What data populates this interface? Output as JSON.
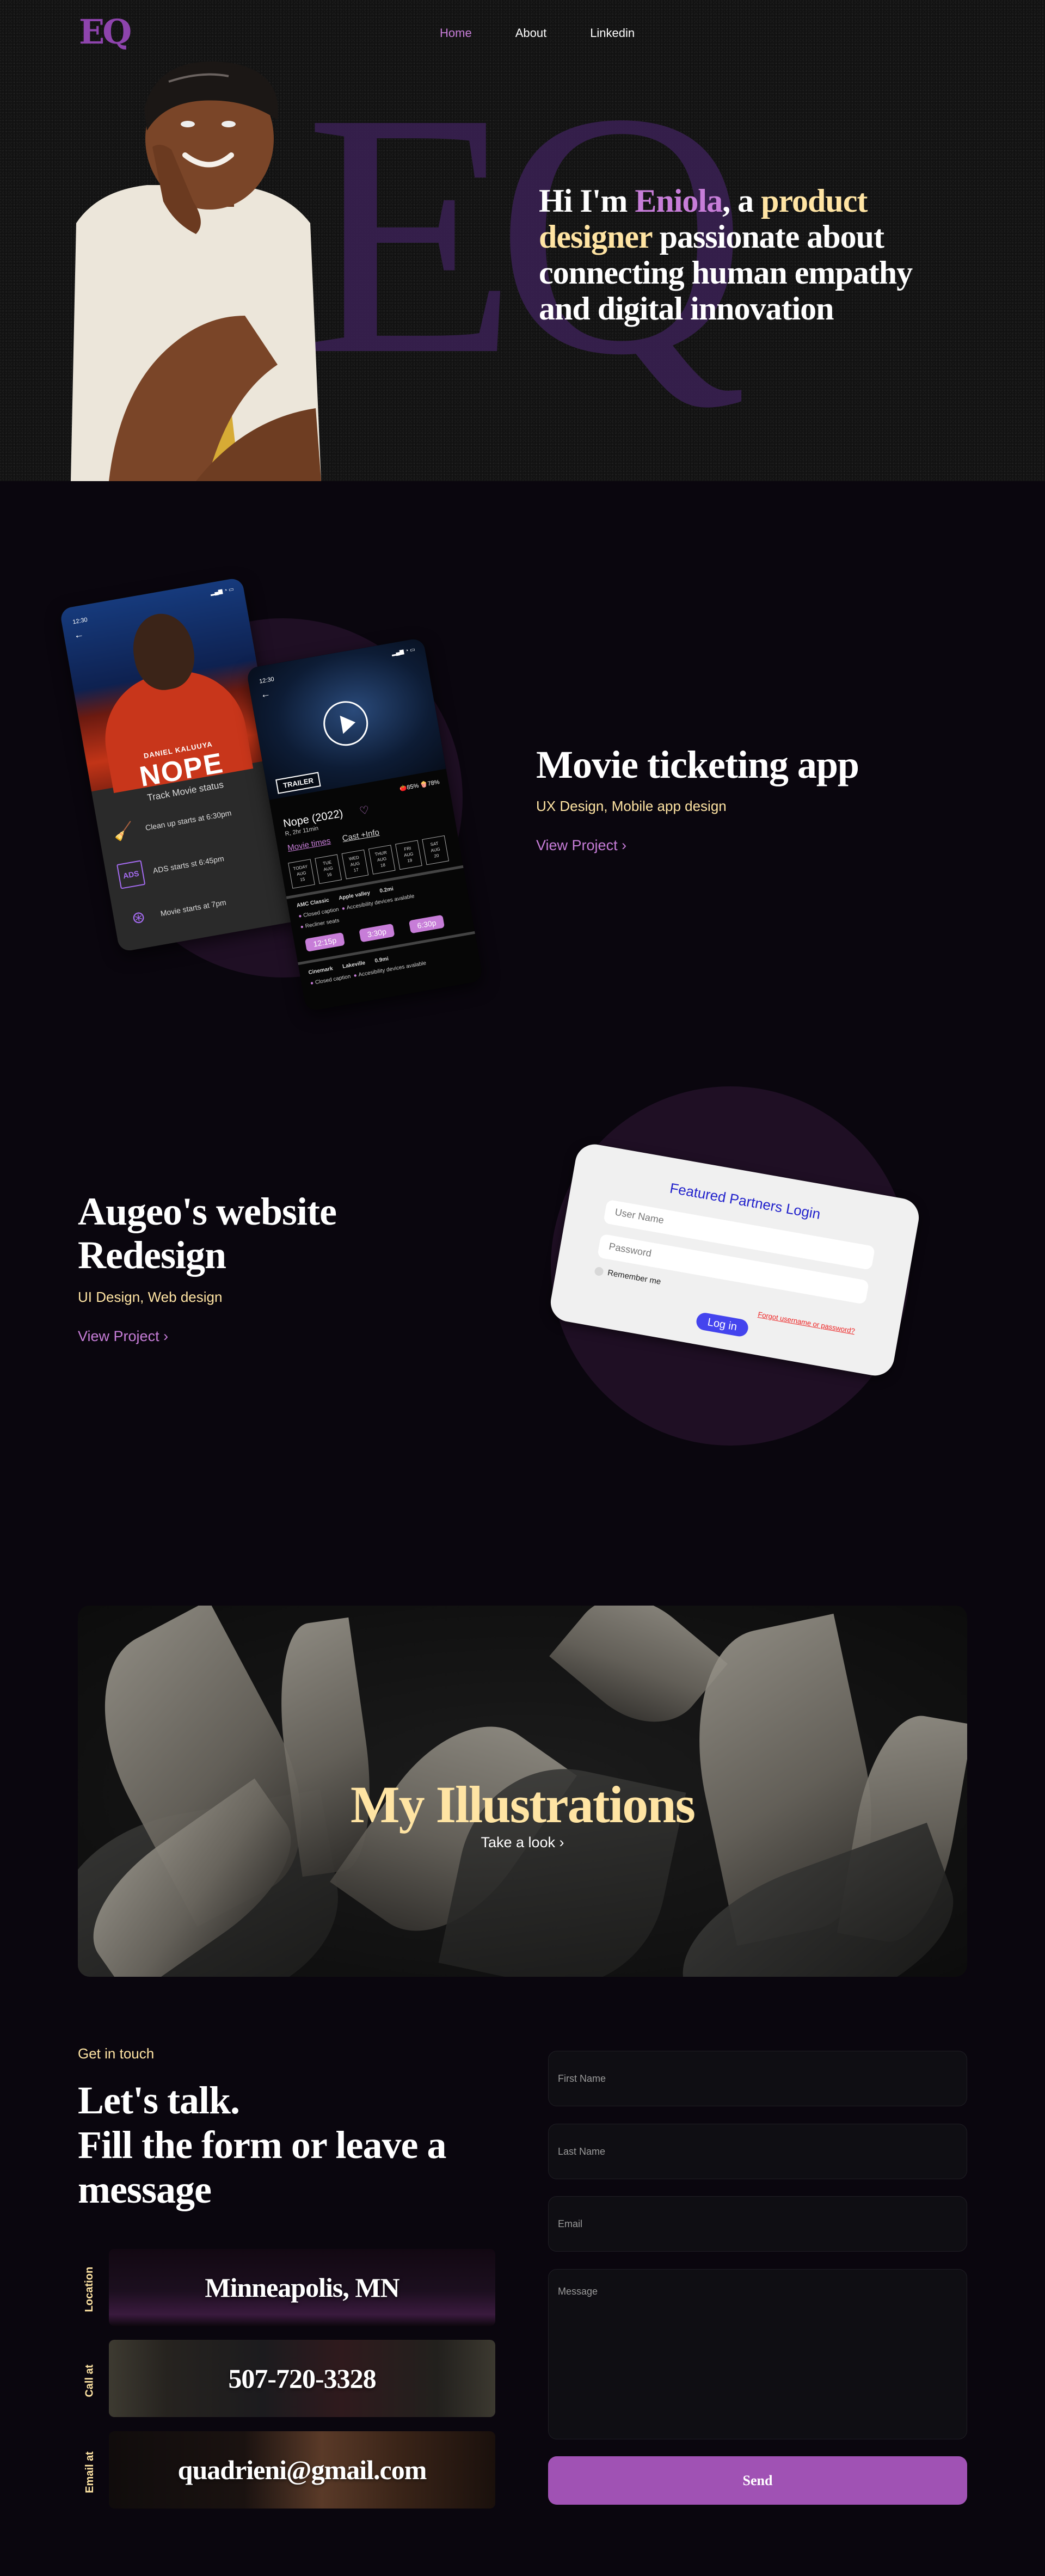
{
  "header": {
    "logo": "EQ",
    "nav": [
      {
        "label": "Home",
        "active": true
      },
      {
        "label": "About",
        "active": false
      },
      {
        "label": "Linkedin",
        "active": false
      }
    ]
  },
  "hero": {
    "background_monogram": "EQ",
    "headline": {
      "part1": "Hi I'm ",
      "name": "Eniola",
      "part2": ", a ",
      "role": "product designer",
      "part3": " passionate about connecting human empathy and digital innovation"
    }
  },
  "projects": [
    {
      "title": "Movie ticketing app",
      "tags": "UX Design, Mobile app design",
      "link_label": "View Project",
      "mockup": {
        "screen1": {
          "time": "12:30",
          "actor": "DANIEL KALUUYA",
          "movie": "NOPE",
          "section_title": "Track Movie status",
          "steps": [
            {
              "icon": "cleaning-person-icon",
              "text": "Clean up starts at 6:30pm"
            },
            {
              "icon": "ads-icon",
              "text": "ADS starts st 6:45pm"
            },
            {
              "icon": "film-reel-icon",
              "text": "Movie starts at 7pm"
            }
          ]
        },
        "screen2": {
          "time": "12:30",
          "trailer_label": "TRAILER",
          "ratings": {
            "tomato": "85%",
            "popcorn": "78%"
          },
          "title": "Nope (2022)",
          "meta": "R, 2hr 11min",
          "tabs": [
            "Movie times",
            "Cast +Info"
          ],
          "dates": [
            {
              "day": "TODAY",
              "month": "AUG",
              "date": "15"
            },
            {
              "day": "TUE",
              "month": "AUG",
              "date": "16"
            },
            {
              "day": "WED",
              "month": "AUG",
              "date": "17"
            },
            {
              "day": "THUR",
              "month": "AUG",
              "date": "18"
            },
            {
              "day": "FRI",
              "month": "AUG",
              "date": "19"
            },
            {
              "day": "SAT",
              "month": "AUG",
              "date": "20"
            }
          ],
          "cinemas": [
            {
              "name": "AMC Classic",
              "city": "Apple valley",
              "distance": "0.2mi",
              "features": [
                "Closed caption",
                "Accesibility devices avalable",
                "Recliner seats"
              ],
              "times": [
                "12:15p",
                "3:30p",
                "6:30p"
              ]
            },
            {
              "name": "Cinemark",
              "city": "Lakeville",
              "distance": "0.9mi",
              "features": [
                "Closed caption",
                "Accesibility devices avalable"
              ],
              "times": []
            }
          ]
        }
      }
    },
    {
      "title": "Augeo's website Redesign",
      "tags": "UI Design, Web design",
      "link_label": "View Project",
      "mockup": {
        "title": "Featured Partners Login",
        "username_placeholder": "User Name",
        "password_placeholder": "Password",
        "remember_label": "Remember me",
        "forgot_label": "Forgot username or password?",
        "login_label": "Log in"
      }
    }
  ],
  "illustrations": {
    "title": "My Illustrations",
    "link_label": "Take a look"
  },
  "contact": {
    "eyebrow": "Get in touch",
    "title_line1": "Let's talk.",
    "title_line2": "Fill the form or leave a message",
    "cards": [
      {
        "label": "Location",
        "value": "Minneapolis, MN"
      },
      {
        "label": "Call at",
        "value": "507-720-3328"
      },
      {
        "label": "Email at",
        "value": "quadrieni@gmail.com"
      }
    ],
    "form": {
      "first_name_placeholder": "First Name",
      "last_name_placeholder": "Last Name",
      "email_placeholder": "Email",
      "message_placeholder": "Message",
      "submit_label": "Send"
    }
  },
  "colors": {
    "accent_purple": "#c77dd8",
    "accent_gold": "#ffe4a3",
    "button_purple": "#a052b4",
    "background": "#0a060e"
  }
}
